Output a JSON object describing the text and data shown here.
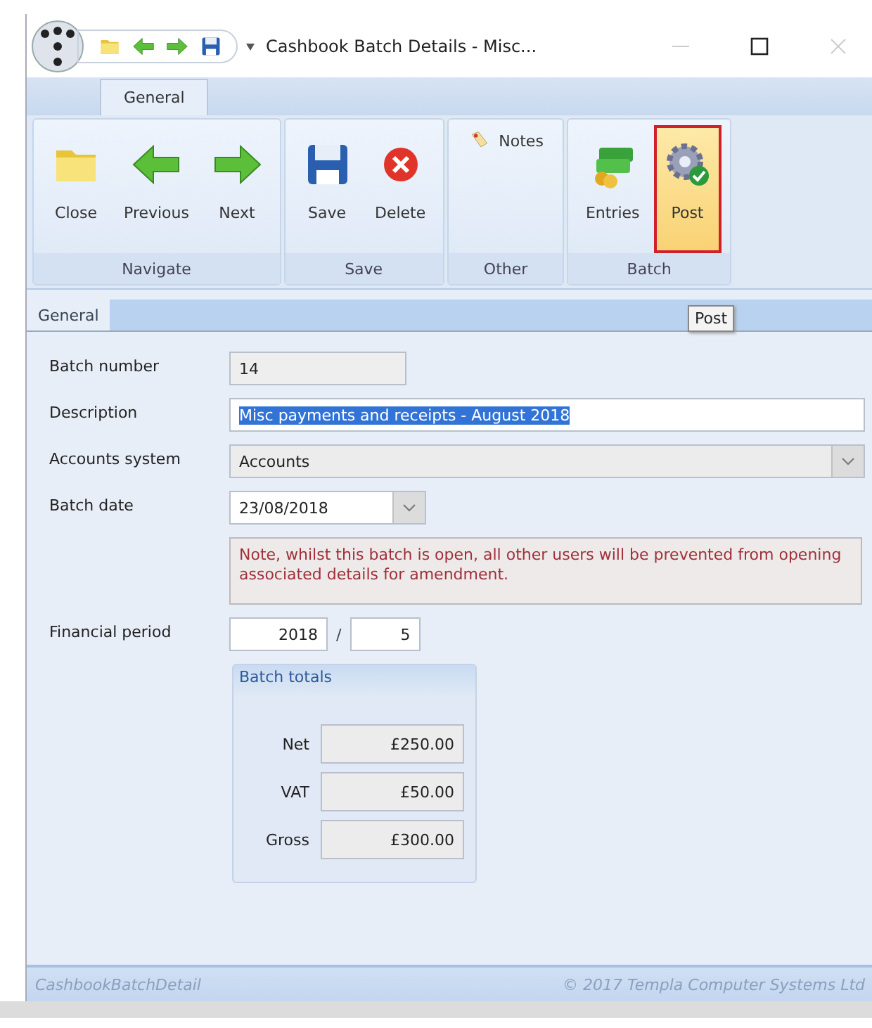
{
  "window": {
    "title": "Cashbook Batch Details - Misc..."
  },
  "ribbon": {
    "tabs": [
      {
        "label": "General",
        "selected": true
      }
    ],
    "groups": [
      {
        "label": "Navigate",
        "buttons": [
          {
            "label": "Close",
            "kind": "folder",
            "highlighted": false
          },
          {
            "label": "Previous",
            "kind": "back",
            "highlighted": false
          },
          {
            "label": "Next",
            "kind": "forward",
            "highlighted": false
          }
        ]
      },
      {
        "label": "Save",
        "buttons": [
          {
            "label": "Save",
            "kind": "save",
            "highlighted": false
          },
          {
            "label": "Delete",
            "kind": "delete",
            "highlighted": false
          }
        ]
      },
      {
        "label": "Other",
        "buttons": [
          {
            "label": "Notes",
            "kind": "notes",
            "highlighted": false
          }
        ]
      },
      {
        "label": "Batch",
        "buttons": [
          {
            "label": "Entries",
            "kind": "entries",
            "highlighted": false
          },
          {
            "label": "Post",
            "kind": "post",
            "highlighted": true
          }
        ]
      }
    ]
  },
  "tooltip": {
    "text": "Post"
  },
  "form": {
    "tabs": [
      {
        "label": "General",
        "selected": true
      }
    ],
    "fields": [
      {
        "label": "Batch number",
        "kind": "readonly",
        "value": "14",
        "selected": false
      },
      {
        "label": "Description",
        "kind": "text",
        "value": "Misc payments and receipts - August 2018",
        "selected": true
      },
      {
        "label": "Accounts system",
        "kind": "combo",
        "value": "Accounts",
        "selected": false
      },
      {
        "label": "Batch date",
        "kind": "date",
        "value": "23/08/2018",
        "selected": false
      }
    ],
    "note": "Note, whilst this batch is open, all other users will be prevented from opening associated details for amendment.",
    "financial_period": {
      "label": "Financial period",
      "year": "2018",
      "separator": "/",
      "period": "5"
    },
    "totals": {
      "title": "Batch totals",
      "rows": [
        {
          "label": "Net",
          "value": "£250.00"
        },
        {
          "label": "VAT",
          "value": "£50.00"
        },
        {
          "label": "Gross",
          "value": "£300.00"
        }
      ]
    }
  },
  "status_bar": {
    "left": "CashbookBatchDetail",
    "right": "© 2017 Templa Computer Systems Ltd"
  }
}
